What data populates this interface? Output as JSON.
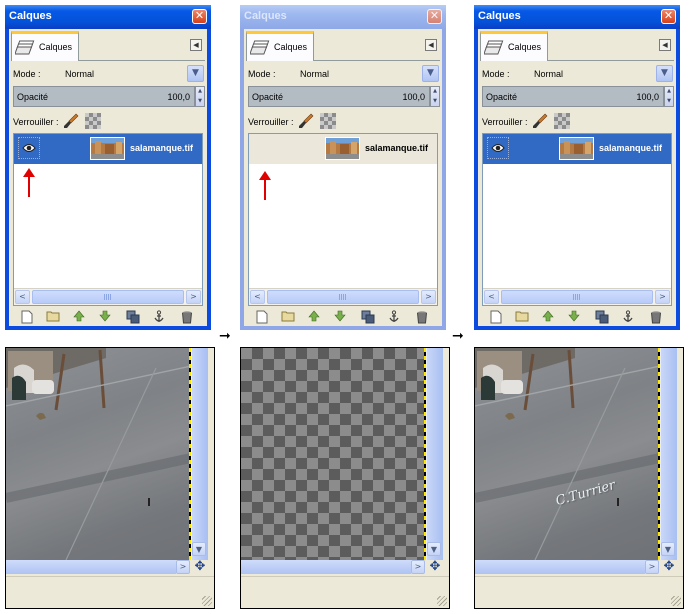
{
  "panels": [
    {
      "state": "active",
      "title": "Calques",
      "tab_label": "Calques",
      "mode_label": "Mode :",
      "mode_value": "Normal",
      "opacity_label": "Opacité",
      "opacity_value": "100,0",
      "lock_label": "Verrouiller :",
      "layer_name": "salamanque.tif",
      "layer_selected": true,
      "layer_visible": true
    },
    {
      "state": "inactive",
      "title": "Calques",
      "tab_label": "Calques",
      "mode_label": "Mode :",
      "mode_value": "Normal",
      "opacity_label": "Opacité",
      "opacity_value": "100,0",
      "lock_label": "Verrouiller :",
      "layer_name": "salamanque.tif",
      "layer_selected": false,
      "layer_visible": false
    },
    {
      "state": "active",
      "title": "Calques",
      "tab_label": "Calques",
      "mode_label": "Mode :",
      "mode_value": "Normal",
      "opacity_label": "Opacité",
      "opacity_value": "100,0",
      "lock_label": "Verrouiller :",
      "layer_name": "salamanque.tif",
      "layer_selected": true,
      "layer_visible": true
    }
  ],
  "canvases": [
    {
      "content": "photo"
    },
    {
      "content": "transparent"
    },
    {
      "content": "photo",
      "signature": "C.Turrier"
    }
  ],
  "icons": {
    "close": "close-icon",
    "eye": "eye-icon",
    "brush": "brush-icon",
    "lock_alpha": "checkerboard-icon",
    "new_layer": "new-page-icon",
    "new_group": "folder-icon",
    "raise": "arrow-up-icon",
    "lower": "arrow-down-icon",
    "duplicate": "duplicate-icon",
    "anchor": "anchor-icon",
    "delete": "trash-icon",
    "navigate": "four-way-arrow-icon"
  },
  "colors": {
    "selected_row": "#316ac5",
    "active_title": "#0758e6",
    "inactive_title": "#9db7ef",
    "annotation_arrow": "#e00000"
  }
}
